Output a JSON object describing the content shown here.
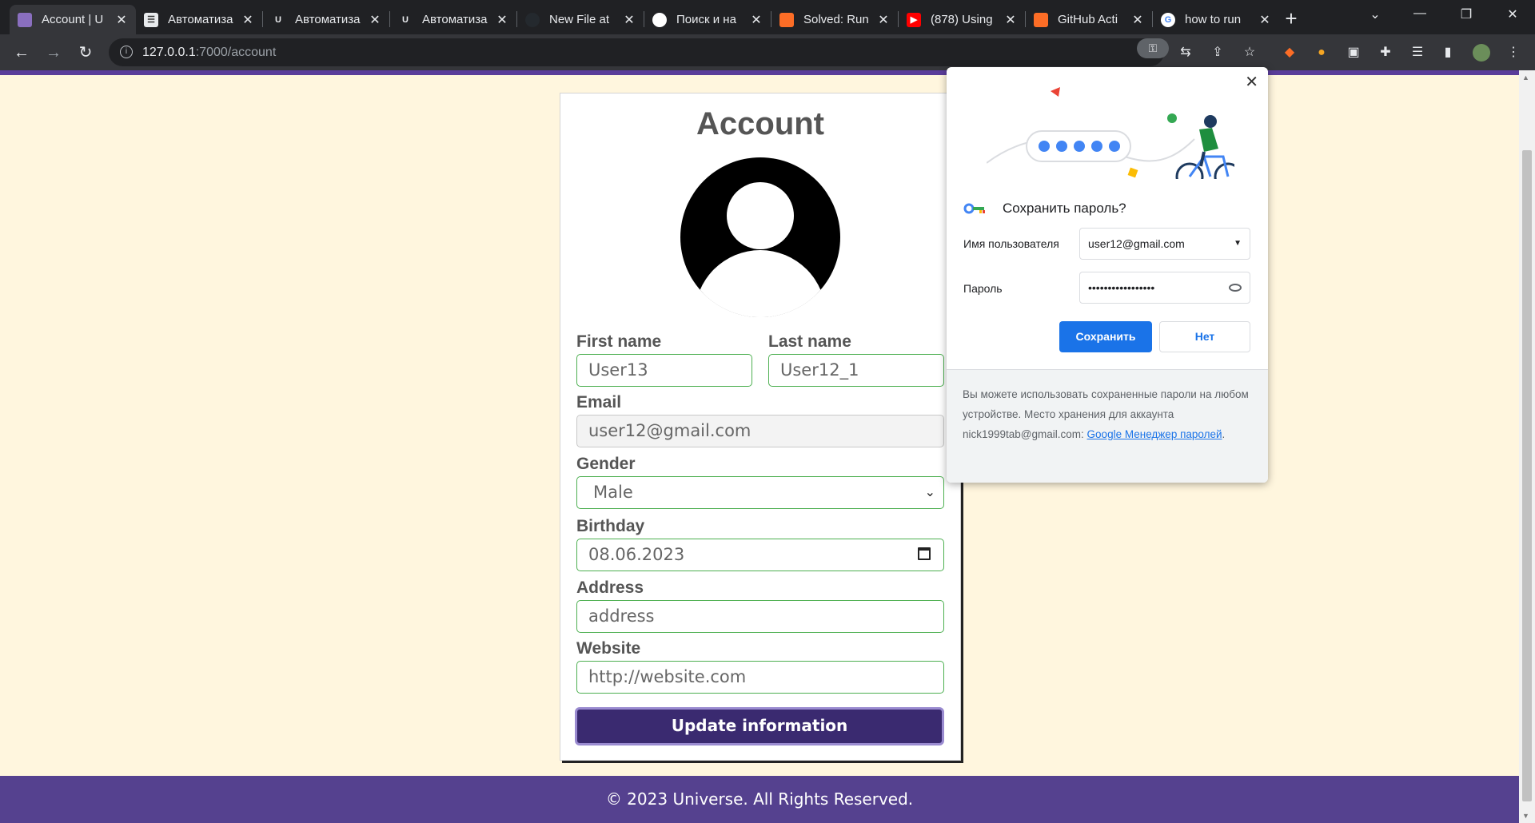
{
  "tabs": [
    {
      "title": "Account | U",
      "favicon": "purple-square-icon",
      "color": "#8a6fbf"
    },
    {
      "title": "Автоматиза",
      "favicon": "doc-icon",
      "color": "#e8eaed"
    },
    {
      "title": "Автоматиза",
      "favicon": "udemy-icon",
      "color": "#e8eaed"
    },
    {
      "title": "Автоматиза",
      "favicon": "udemy-icon",
      "color": "#e8eaed"
    },
    {
      "title": "New File at",
      "favicon": "github-icon",
      "color": "#24292e"
    },
    {
      "title": "Поиск и на",
      "favicon": "github-icon",
      "color": "#ffffff"
    },
    {
      "title": "Solved: Run",
      "favicon": "gitlab-icon",
      "color": "#fc6d26"
    },
    {
      "title": "(878) Using",
      "favicon": "youtube-icon",
      "color": "#ff0000"
    },
    {
      "title": "GitHub Acti",
      "favicon": "gitlab-icon",
      "color": "#fc6d26"
    },
    {
      "title": "how to run",
      "favicon": "google-icon",
      "color": "#4285f4"
    }
  ],
  "address_bar": {
    "host": "127.0.0.1",
    "path": ":7000/account"
  },
  "page": {
    "title": "Account",
    "first_name_label": "First name",
    "first_name_value": "User13",
    "last_name_label": "Last name",
    "last_name_value": "User12_1",
    "email_label": "Email",
    "email_value": "user12@gmail.com",
    "gender_label": "Gender",
    "gender_value": "Male",
    "birthday_label": "Birthday",
    "birthday_value": "08.06.2023",
    "address_label": "Address",
    "address_placeholder": "address",
    "website_label": "Website",
    "website_placeholder": "http://website.com",
    "update_button": "Update information",
    "footer": "© 2023 Universe. All Rights Reserved."
  },
  "password_popup": {
    "title": "Сохранить пароль?",
    "username_label": "Имя пользователя",
    "username_value": "user12@gmail.com",
    "password_label": "Пароль",
    "password_value": "•••••••••••••••••",
    "save_button": "Сохранить",
    "no_button": "Нет",
    "footer_text": "Вы можете использовать сохраненные пароли на любом устройстве. Место хранения для аккаунта nick1999tab@gmail.com:",
    "footer_link": "Google Менеджер паролей",
    "footer_end": "."
  },
  "colors": {
    "accent": "#55418f",
    "button": "#3a2a70",
    "input_border": "#4caf50",
    "page_bg": "#fff6de",
    "popup_save": "#1a73e8"
  }
}
